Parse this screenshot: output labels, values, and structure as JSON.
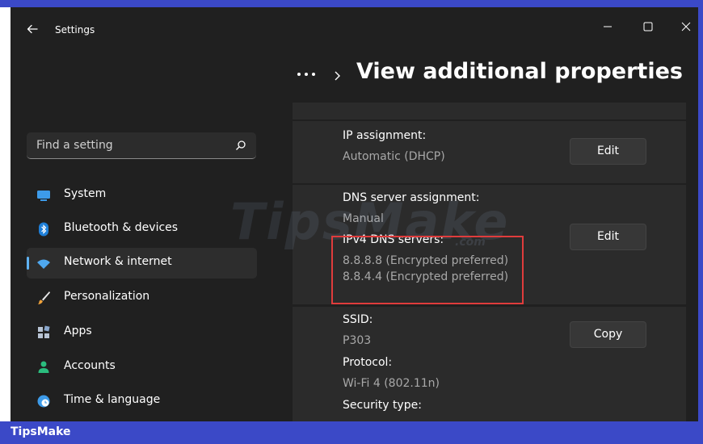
{
  "window": {
    "title": "Settings"
  },
  "header": {
    "title": "View additional properties"
  },
  "search": {
    "placeholder": "Find a setting"
  },
  "sidebar": {
    "items": [
      {
        "label": "System",
        "icon": "monitor-icon"
      },
      {
        "label": "Bluetooth & devices",
        "icon": "bluetooth-icon"
      },
      {
        "label": "Network & internet",
        "icon": "wifi-icon",
        "selected": true
      },
      {
        "label": "Personalization",
        "icon": "brush-icon"
      },
      {
        "label": "Apps",
        "icon": "apps-icon"
      },
      {
        "label": "Accounts",
        "icon": "person-icon"
      },
      {
        "label": "Time & language",
        "icon": "globe-clock-icon"
      }
    ]
  },
  "properties": {
    "ip": {
      "label": "IP assignment:",
      "value": "Automatic (DHCP)",
      "button": "Edit"
    },
    "dns": {
      "label": "DNS server assignment:",
      "value": "Manual",
      "ipv4_label": "IPv4 DNS servers:",
      "servers": [
        "8.8.8.8 (Encrypted preferred)",
        "8.8.4.4 (Encrypted preferred)"
      ],
      "button": "Edit"
    },
    "wifi": {
      "ssid_label": "SSID:",
      "ssid_value": "P303",
      "protocol_label": "Protocol:",
      "protocol_value": "Wi-Fi 4 (802.11n)",
      "security_label": "Security type:",
      "button": "Copy"
    }
  },
  "watermark": {
    "text": "TipsMake",
    "sub": ".com"
  },
  "footer": {
    "brand": "TipsMake"
  },
  "colors": {
    "accent": "#5fb2f2",
    "frame": "#3b49c7",
    "highlight": "#e03c3c",
    "background": "#202020"
  }
}
